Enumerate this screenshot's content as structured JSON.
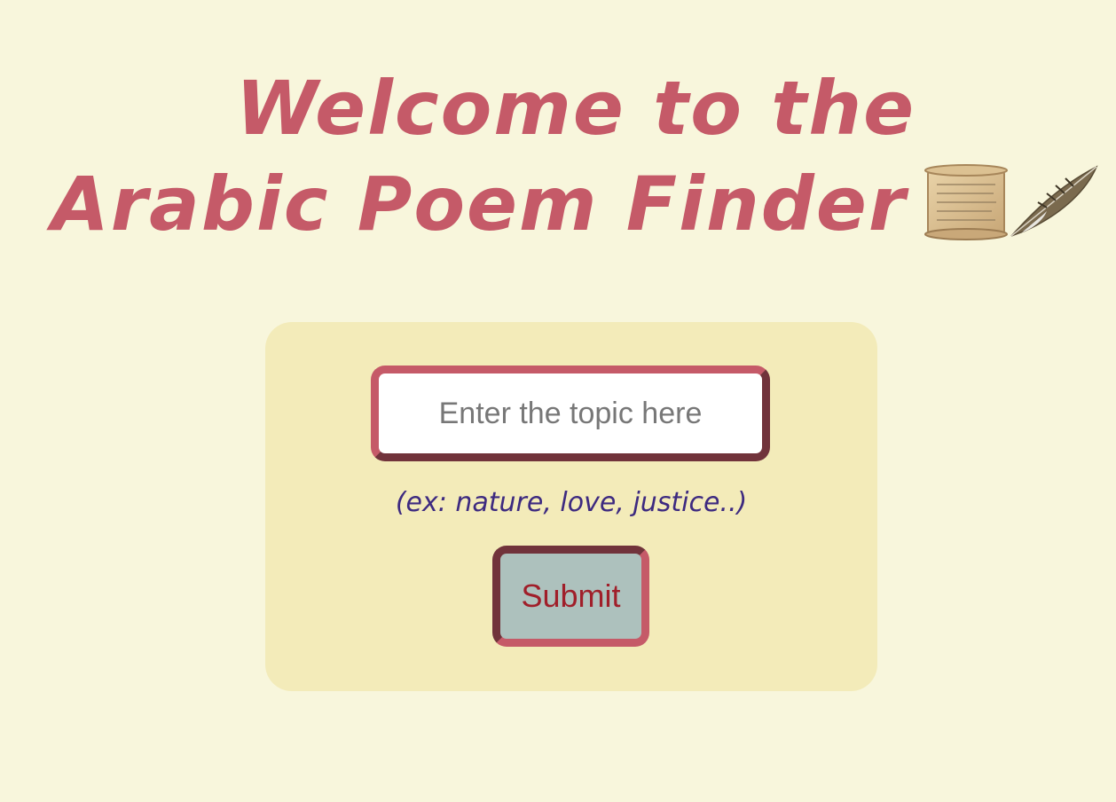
{
  "header": {
    "title_line1": "Welcome to the",
    "title_line2": "Arabic Poem Finder",
    "icons": [
      "scroll-icon",
      "feather-quill-icon"
    ]
  },
  "form": {
    "topic_placeholder": "Enter the topic here",
    "topic_value": "",
    "hint": "(ex: nature, love, justice..)",
    "submit_label": "Submit"
  },
  "colors": {
    "background": "#f8f6dc",
    "card": "#f3ebb9",
    "title": "#c55a68",
    "hint": "#3d2a80",
    "button_bg": "#adc1bd",
    "button_text": "#a01f2a"
  }
}
